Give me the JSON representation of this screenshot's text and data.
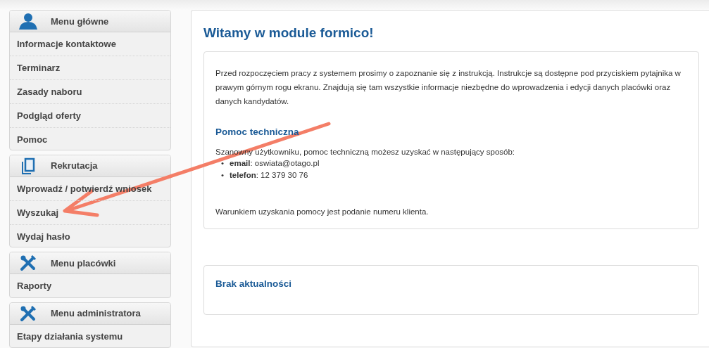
{
  "sidebar": {
    "sections": [
      {
        "title": "Menu główne",
        "kind": "person",
        "items": [
          {
            "label": "Informacje kontaktowe"
          },
          {
            "label": "Terminarz"
          },
          {
            "label": "Zasady naboru"
          },
          {
            "label": "Podgląd oferty"
          },
          {
            "label": "Pomoc"
          }
        ]
      },
      {
        "title": "Rekrutacja",
        "kind": "document",
        "items": [
          {
            "label": "Wprowadź / potwierdź wniosek"
          },
          {
            "label": "Wyszukaj"
          },
          {
            "label": "Wydaj hasło"
          }
        ]
      },
      {
        "title": "Menu placówki",
        "kind": "tools",
        "items": [
          {
            "label": "Raporty"
          }
        ]
      },
      {
        "title": "Menu administratora",
        "kind": "tools",
        "items": [
          {
            "label": "Etapy działania systemu"
          }
        ]
      }
    ]
  },
  "main": {
    "title": "Witamy w module formico!",
    "intro": "Przed rozpoczęciem pracy z systemem prosimy o zapoznanie się z instrukcją. Instrukcje są dostępne pod przyciskiem pytajnika w prawym górnym rogu ekranu. Znajdują się tam wszystkie informacje niezbędne do wprowadzenia i edycji danych placówki oraz danych kandydatów.",
    "help_heading": "Pomoc techniczna",
    "help_intro": "Szanowny użytkowniku, pomoc techniczną możesz uzyskać w następujący sposób:",
    "contacts": [
      {
        "marker": "•",
        "text": "**email**: oswiata@otago.pl"
      },
      {
        "marker": "•",
        "text": "**telefon**: 12 379 30 76"
      }
    ],
    "help_note": "Warunkiem uzyskania pomocy jest podanie numeru klienta.",
    "news_heading": "Brak aktualności"
  }
}
